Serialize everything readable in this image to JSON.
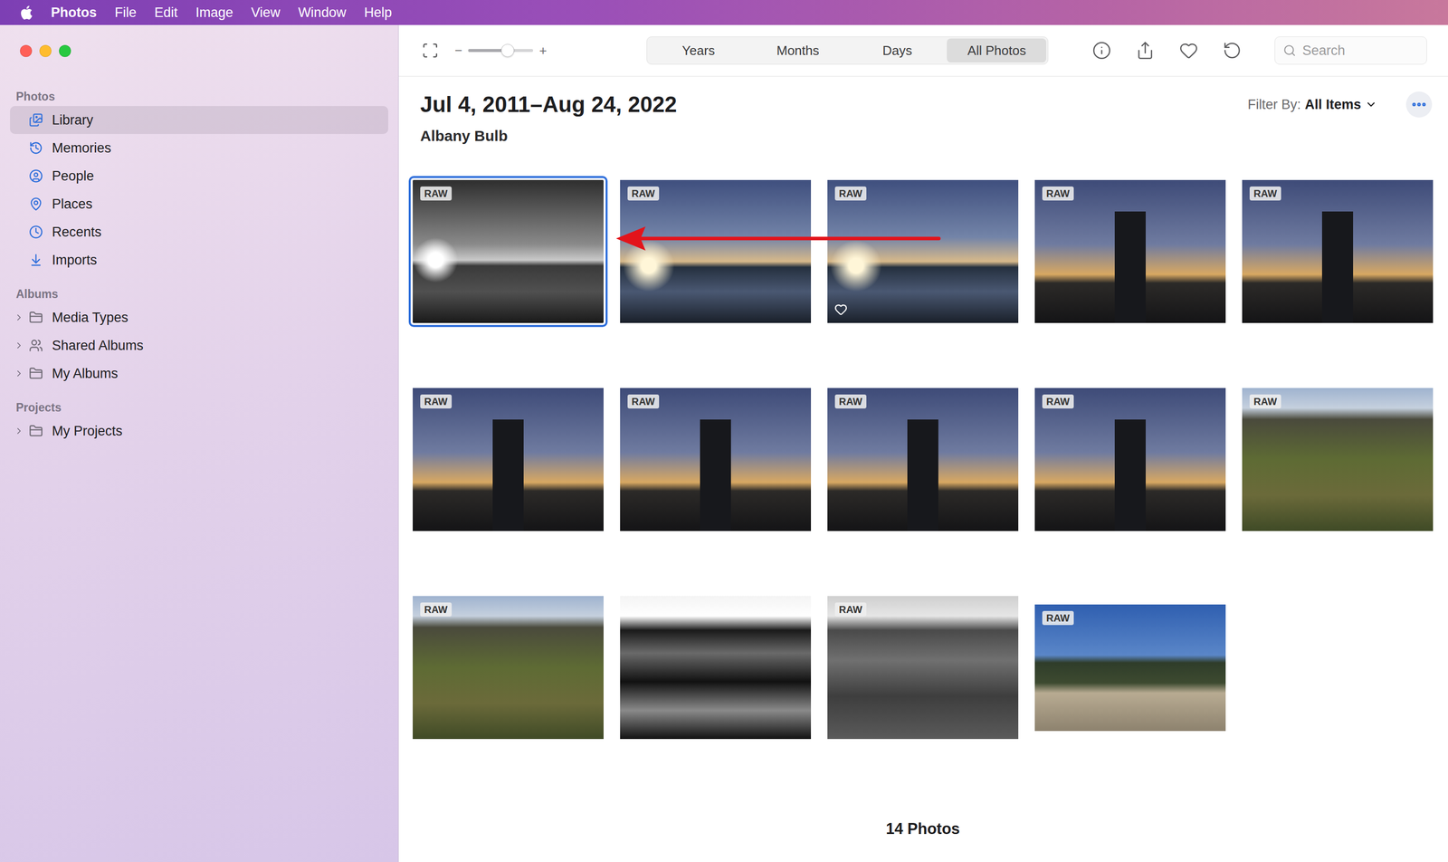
{
  "menu_bar": {
    "app": "Photos",
    "items": [
      "File",
      "Edit",
      "Image",
      "View",
      "Window",
      "Help"
    ]
  },
  "sidebar": {
    "sections": [
      {
        "title": "Photos",
        "items": [
          {
            "label": "Library",
            "selected": true
          },
          {
            "label": "Memories",
            "selected": false
          },
          {
            "label": "People",
            "selected": false
          },
          {
            "label": "Places",
            "selected": false
          },
          {
            "label": "Recents",
            "selected": false
          },
          {
            "label": "Imports",
            "selected": false
          }
        ]
      },
      {
        "title": "Albums",
        "items": [
          {
            "label": "Media Types",
            "selected": false,
            "expanded": false
          },
          {
            "label": "Shared Albums",
            "selected": false,
            "expanded": false
          },
          {
            "label": "My Albums",
            "selected": false,
            "expanded": false
          }
        ]
      },
      {
        "title": "Projects",
        "items": [
          {
            "label": "My Projects",
            "selected": false,
            "expanded": false
          }
        ]
      }
    ]
  },
  "toolbar": {
    "zoom": {
      "minus": "−",
      "plus": "+",
      "level": 0.61
    },
    "views": [
      {
        "label": "Years",
        "selected": false
      },
      {
        "label": "Months",
        "selected": false
      },
      {
        "label": "Days",
        "selected": false
      },
      {
        "label": "All Photos",
        "selected": true
      }
    ],
    "search": {
      "placeholder": "Search"
    }
  },
  "header": {
    "title": "Jul 4, 2011–Aug 24, 2022",
    "subtitle": "Albany Bulb",
    "filter_label": "Filter By:",
    "filter_value": "All Items"
  },
  "photos": [
    {
      "kind": "harbor-bw",
      "badge": "RAW",
      "selected": true,
      "favorite": false
    },
    {
      "kind": "harbor",
      "badge": "RAW",
      "selected": false,
      "favorite": false
    },
    {
      "kind": "harbor",
      "badge": "RAW",
      "selected": false,
      "favorite": true
    },
    {
      "kind": "statue",
      "badge": "RAW",
      "selected": false,
      "favorite": false
    },
    {
      "kind": "statue",
      "badge": "RAW",
      "selected": false,
      "favorite": false
    },
    {
      "kind": "statue",
      "badge": "RAW",
      "selected": false,
      "favorite": false
    },
    {
      "kind": "statue",
      "badge": "RAW",
      "selected": false,
      "favorite": false
    },
    {
      "kind": "statue",
      "badge": "RAW",
      "selected": false,
      "favorite": false
    },
    {
      "kind": "statue",
      "badge": "RAW",
      "selected": false,
      "favorite": false
    },
    {
      "kind": "hotel",
      "badge": "RAW",
      "selected": false,
      "favorite": false
    },
    {
      "kind": "hotel",
      "badge": "RAW",
      "selected": false,
      "favorite": false
    },
    {
      "kind": "hotel-contrast",
      "badge": "",
      "selected": false,
      "favorite": false
    },
    {
      "kind": "hotel-bw",
      "badge": "RAW",
      "selected": false,
      "favorite": false
    },
    {
      "kind": "trees",
      "badge": "RAW",
      "selected": false,
      "favorite": false
    }
  ],
  "footer": {
    "count": "14 Photos"
  }
}
